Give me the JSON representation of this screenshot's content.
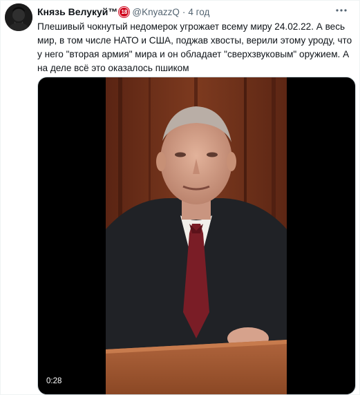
{
  "author": {
    "display_name": "Князь Велукуй™",
    "badge_text": "18",
    "handle": "@KnyazzQ",
    "separator": "·",
    "time": "4 год"
  },
  "tweet": {
    "text_lines": [
      "Плешивый чокнутый недомерок угрожает всему миру 24.02.22. А весь",
      "мир, в том числе НАТО и США, поджав хвосты, верили этому уроду, что",
      "у него \"вторая армия\" мира и он обладает \"сверхзвуковым\" оружием. А",
      "на деле всё это оказалось пшиком"
    ]
  },
  "media": {
    "type": "video",
    "duration": "0:28"
  },
  "icons": {
    "more": "more-options-icon",
    "avatar": "avatar-icon"
  },
  "colors": {
    "secondary_text": "#536471",
    "primary_text": "#0f1419",
    "badge": "#d0021b",
    "media_border": "#cfd9de"
  }
}
